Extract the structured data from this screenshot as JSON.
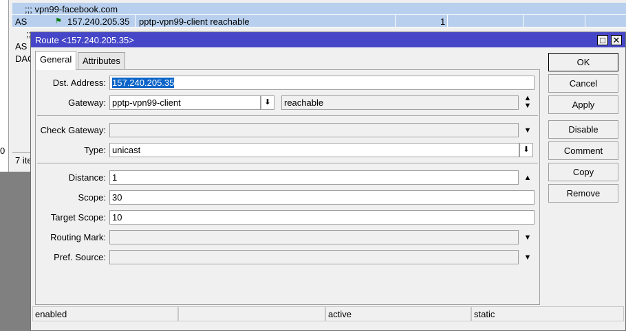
{
  "background": {
    "rows": [
      {
        "name": ";;; vpn99-facebook.com"
      },
      {
        "flags": "AS",
        "dst": "157.240.205.35",
        "gateway": "pptp-vpn99-client reachable",
        "distance": "1"
      }
    ],
    "partial_rows": [
      ";;;",
      "AS",
      "DAC"
    ],
    "status_left": "0",
    "status_items": "7 ite"
  },
  "dialog": {
    "title": "Route <157.240.205.35>",
    "tabs": [
      {
        "label": "General"
      },
      {
        "label": "Attributes"
      }
    ],
    "fields": {
      "dst_address": {
        "label": "Dst. Address:",
        "value": "157.240.205.35"
      },
      "gateway": {
        "label": "Gateway:",
        "value": "pptp-vpn99-client",
        "status": "reachable"
      },
      "check_gateway": {
        "label": "Check Gateway:",
        "value": ""
      },
      "type": {
        "label": "Type:",
        "value": "unicast"
      },
      "distance": {
        "label": "Distance:",
        "value": "1"
      },
      "scope": {
        "label": "Scope:",
        "value": "30"
      },
      "target_scope": {
        "label": "Target Scope:",
        "value": "10"
      },
      "routing_mark": {
        "label": "Routing Mark:",
        "value": ""
      },
      "pref_source": {
        "label": "Pref. Source:",
        "value": ""
      }
    },
    "buttons": {
      "ok": "OK",
      "cancel": "Cancel",
      "apply": "Apply",
      "disable": "Disable",
      "comment": "Comment",
      "copy": "Copy",
      "remove": "Remove"
    },
    "status": [
      "enabled",
      "",
      "active",
      "static"
    ]
  },
  "colors": {
    "titlebar": "#4646c8",
    "row_highlight": "#b8d0ee",
    "selection": "#0a64c8"
  }
}
